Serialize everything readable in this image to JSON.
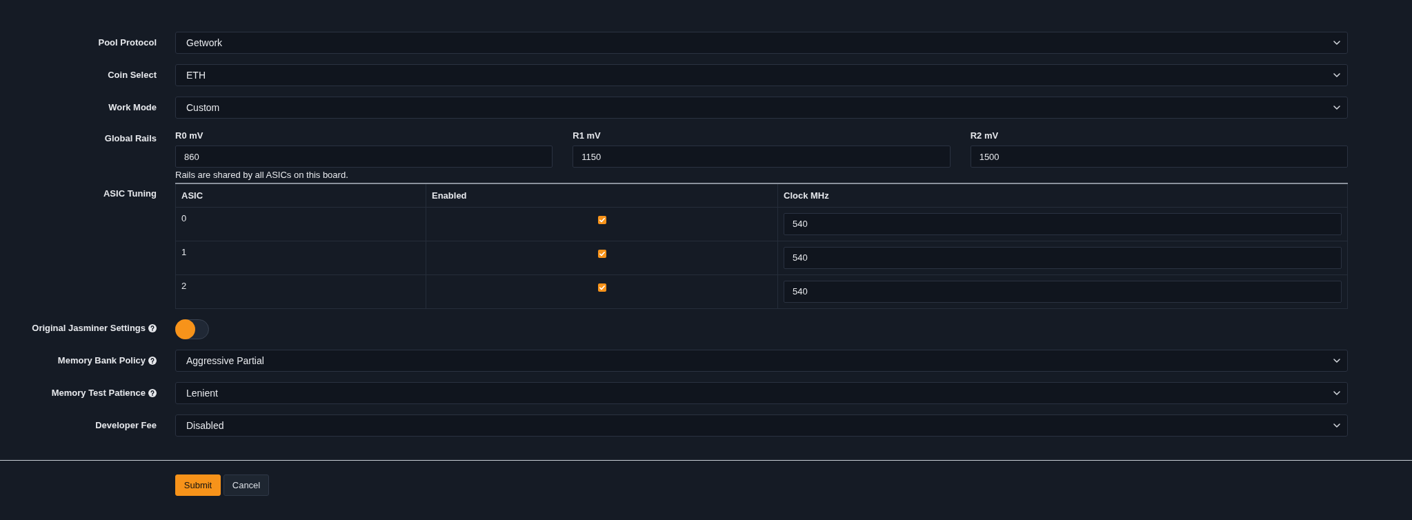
{
  "form": {
    "rows": [
      {
        "kind": "select",
        "label": "Pool Protocol",
        "value": "Getwork"
      },
      {
        "kind": "select",
        "label": "Coin Select",
        "value": "ETH"
      },
      {
        "kind": "select",
        "label": "Work Mode",
        "value": "Custom"
      },
      {
        "kind": "rails",
        "label": "Global Rails",
        "rails": [
          {
            "label": "R0 mV",
            "value": "860"
          },
          {
            "label": "R1 mV",
            "value": "1150"
          },
          {
            "label": "R2 mV",
            "value": "1500"
          }
        ],
        "hint": "Rails are shared by all ASICs on this board."
      },
      {
        "kind": "table",
        "label": "ASIC Tuning",
        "columns": [
          "ASIC",
          "Enabled",
          "Clock MHz"
        ],
        "asics": [
          {
            "asic": "0",
            "enabled": true,
            "clock": "540"
          },
          {
            "asic": "1",
            "enabled": true,
            "clock": "540"
          },
          {
            "asic": "2",
            "enabled": true,
            "clock": "540"
          }
        ]
      },
      {
        "kind": "toggle",
        "label": "Original Jasminer Settings",
        "help": true,
        "on": false
      },
      {
        "kind": "select",
        "label": "Memory Bank Policy",
        "help": true,
        "value": "Aggressive Partial"
      },
      {
        "kind": "select",
        "label": "Memory Test Patience",
        "help": true,
        "value": "Lenient"
      },
      {
        "kind": "select",
        "label": "Developer Fee",
        "value": "Disabled"
      }
    ]
  },
  "buttons": [
    {
      "label": "Submit",
      "kind": "submit"
    },
    {
      "label": "Cancel",
      "kind": "cancel"
    }
  ]
}
